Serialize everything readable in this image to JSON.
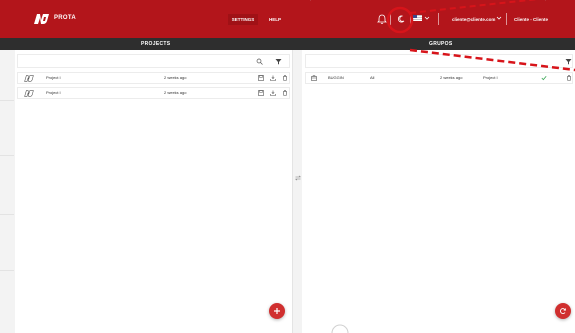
{
  "header": {
    "brand": "PROTA",
    "nav": {
      "settings": "SETTINGS",
      "help": "HELP"
    },
    "user_email": "cliente@cliente.com",
    "user_org": "Cliente - Cliente"
  },
  "subheader": {
    "left_title": "PROJECTS",
    "right_title": "GRUPOS"
  },
  "projects": {
    "rows": [
      {
        "name": "Project I",
        "time": "2 weeks ago"
      },
      {
        "name": "Project I",
        "time": "2 weeks ago"
      }
    ]
  },
  "groups": {
    "rows": [
      {
        "name": "BUGGIN",
        "scope": "All",
        "time": "2 weeks ago",
        "project": "Project I"
      }
    ]
  },
  "colors": {
    "brand_red": "#b3151b",
    "subbar": "#2e2e2e",
    "fab": "#d02f2f",
    "check_green": "#3aa655",
    "annotation": "#d7141a"
  },
  "icons": {
    "bell": "bell-icon",
    "theme": "moon-icon",
    "search": "search-icon",
    "filter": "filter-icon",
    "save": "save-icon",
    "download": "download-icon",
    "delete": "trash-icon",
    "add": "plus-icon",
    "swap": "swap-icon"
  }
}
